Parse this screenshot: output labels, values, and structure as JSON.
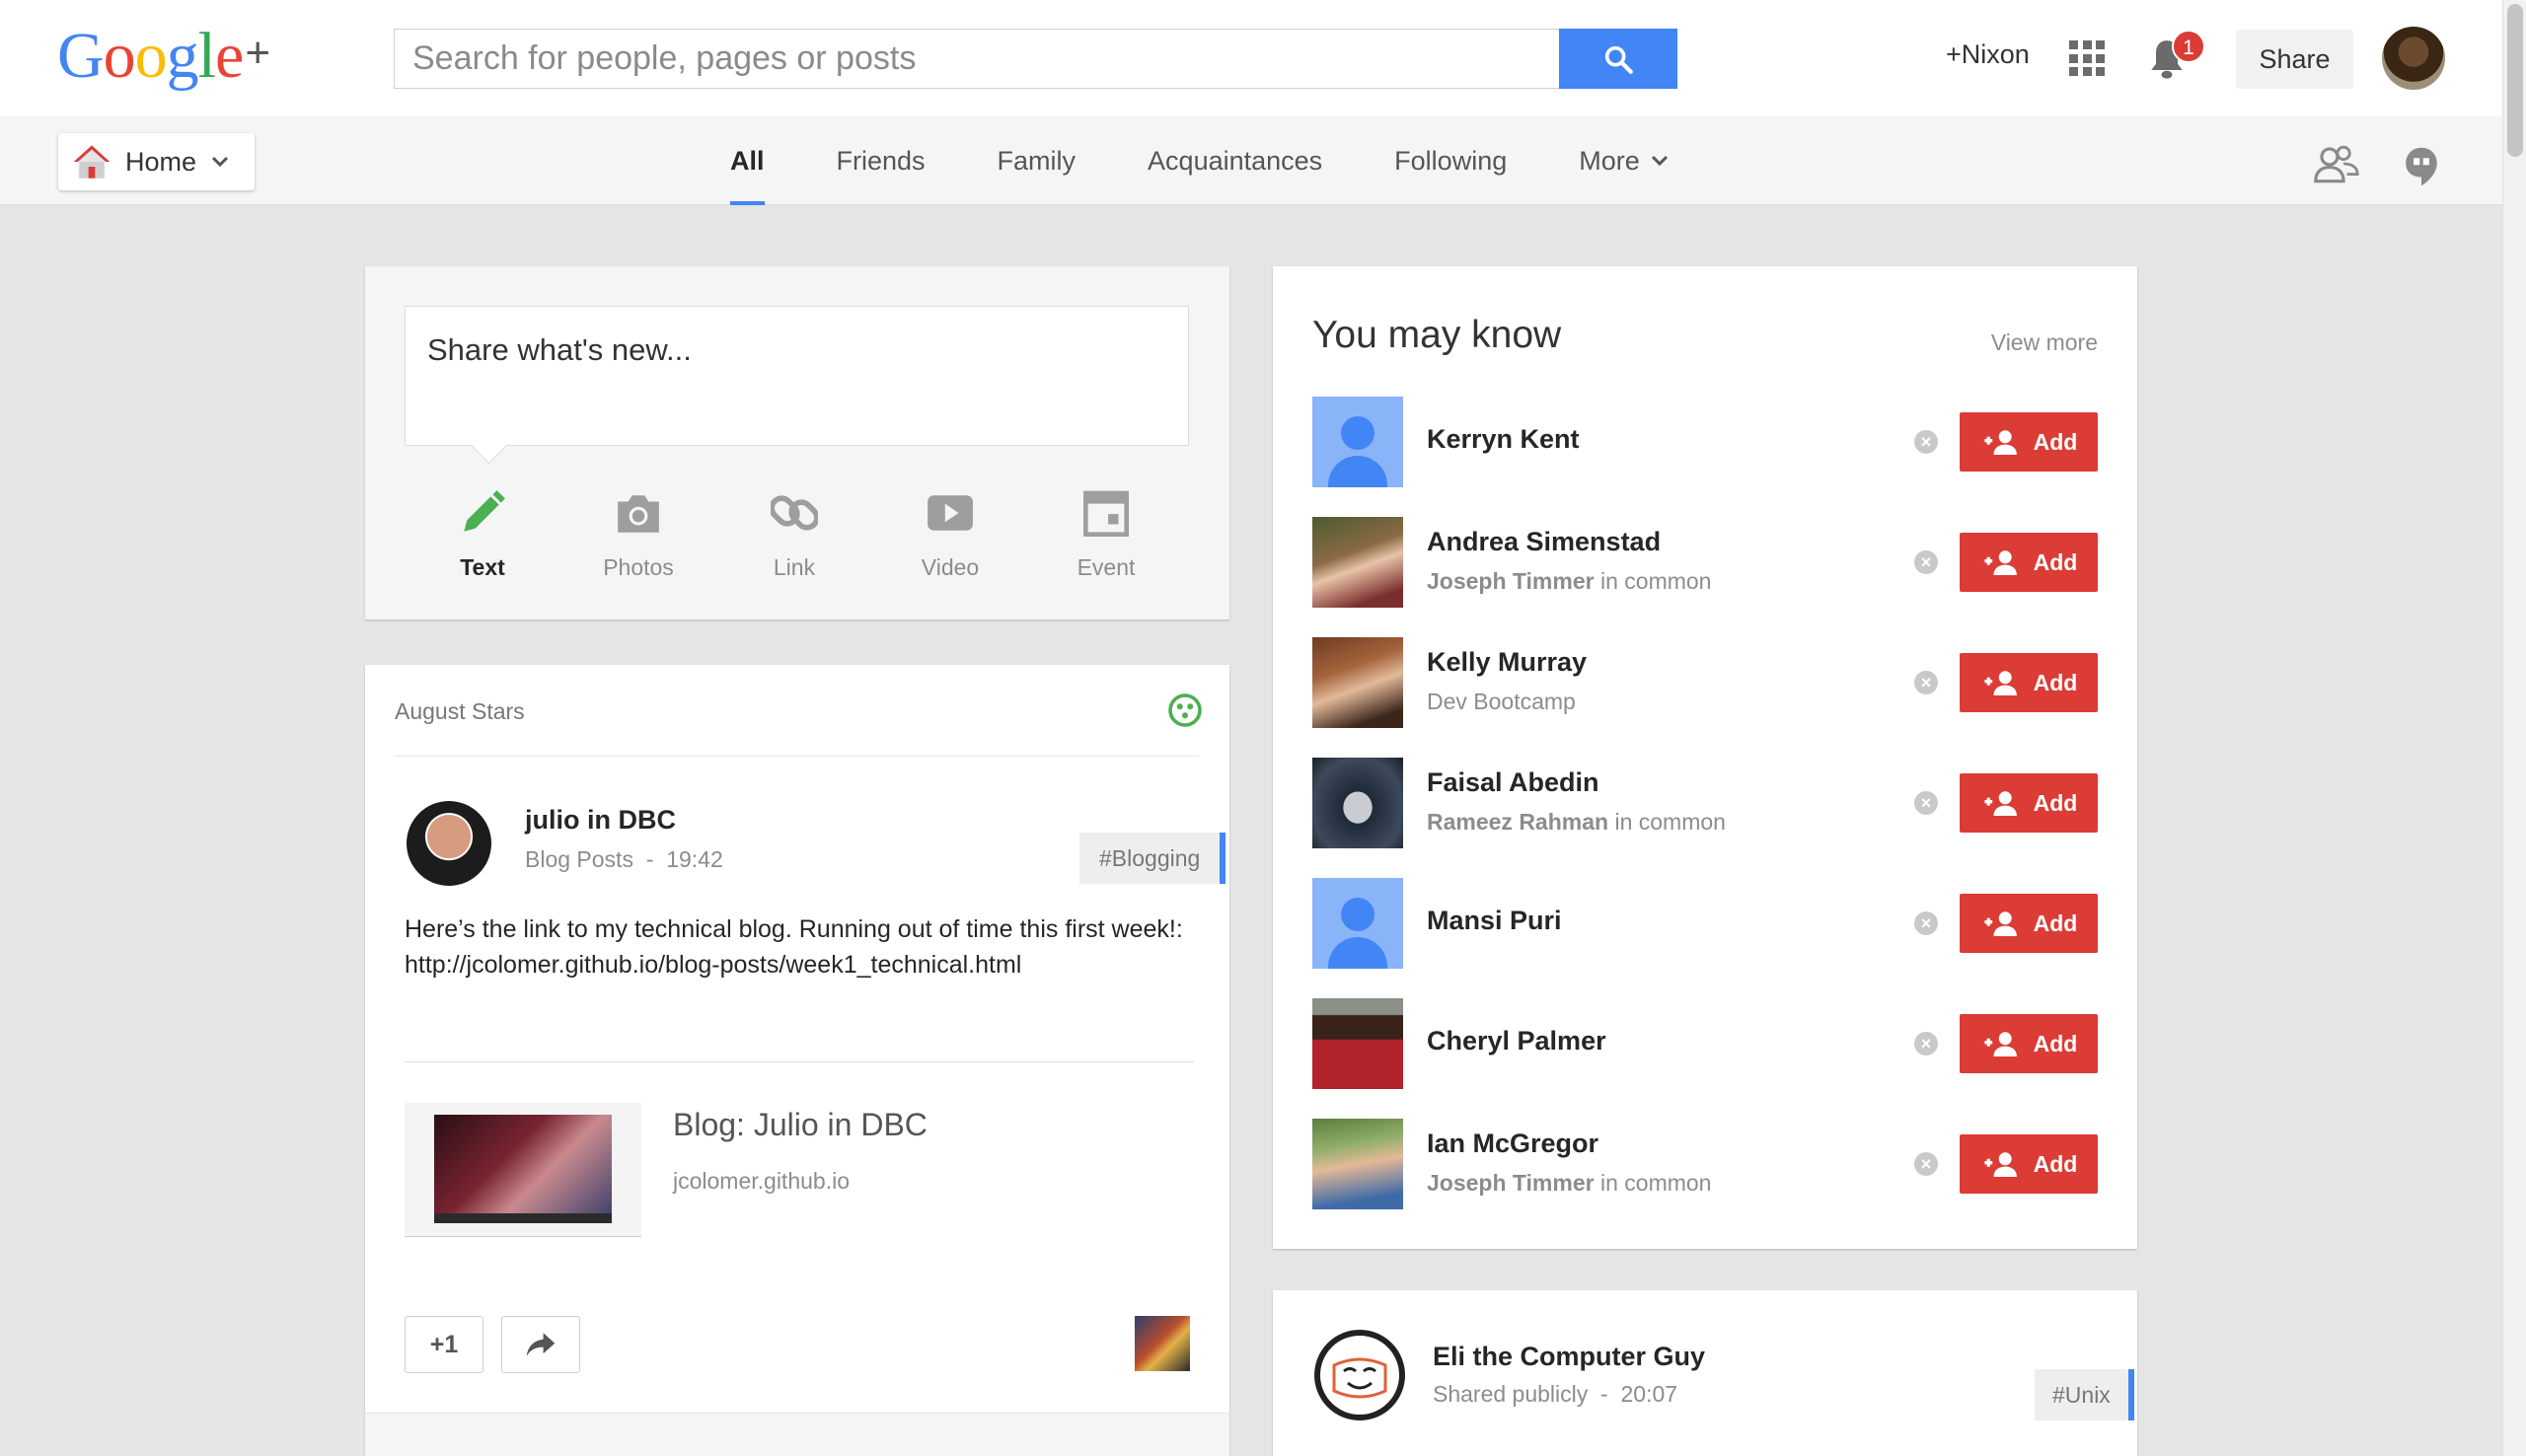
{
  "brand": {
    "logo_chars": [
      "G",
      "o",
      "o",
      "g",
      "l",
      "e"
    ],
    "plus": "+"
  },
  "search": {
    "placeholder": "Search for people, pages or posts",
    "button_icon": "search-icon"
  },
  "header": {
    "profile_name": "+Nixon",
    "notifications_count": "1",
    "share_label": "Share"
  },
  "nav": {
    "home_label": "Home",
    "tabs": [
      "All",
      "Friends",
      "Family",
      "Acquaintances",
      "Following",
      "More"
    ],
    "active_tab": "All"
  },
  "share_box": {
    "placeholder": "Share what's new...",
    "types": [
      "Text",
      "Photos",
      "Link",
      "Video",
      "Event"
    ]
  },
  "post": {
    "community": "August Stars",
    "author": "julio in DBC",
    "category": "Blog Posts",
    "time": "19:42",
    "hashtag": "#Blogging",
    "body_line1": "Here’s the link to my technical blog. Running out of time this first week!:",
    "body_line2": "http://jcolomer.github.io/blog-posts/week1_technical.html",
    "link_title": "Blog: Julio in DBC",
    "link_domain": "jcolomer.github.io",
    "plus_one": "+1"
  },
  "you_may_know": {
    "title": "You may know",
    "view_more": "View more",
    "add_label": "Add",
    "people": [
      {
        "name": "Kerryn Kent",
        "sub_bold": "",
        "sub": ""
      },
      {
        "name": "Andrea Simenstad",
        "sub_bold": "Joseph Timmer",
        "sub": " in common"
      },
      {
        "name": "Kelly Murray",
        "sub_bold": "",
        "sub": "Dev Bootcamp"
      },
      {
        "name": "Faisal Abedin",
        "sub_bold": "Rameez Rahman",
        "sub": " in common"
      },
      {
        "name": "Mansi Puri",
        "sub_bold": "",
        "sub": ""
      },
      {
        "name": "Cheryl Palmer",
        "sub_bold": "",
        "sub": ""
      },
      {
        "name": "Ian McGregor",
        "sub_bold": "Joseph Timmer",
        "sub": " in common"
      }
    ]
  },
  "post2": {
    "author": "Eli the Computer Guy",
    "visibility": "Shared publicly",
    "time": "20:07",
    "hashtag": "#Unix"
  },
  "colors": {
    "accent_blue": "#4285f4",
    "add_red": "#db3c36",
    "text_active": "#4caf50"
  }
}
